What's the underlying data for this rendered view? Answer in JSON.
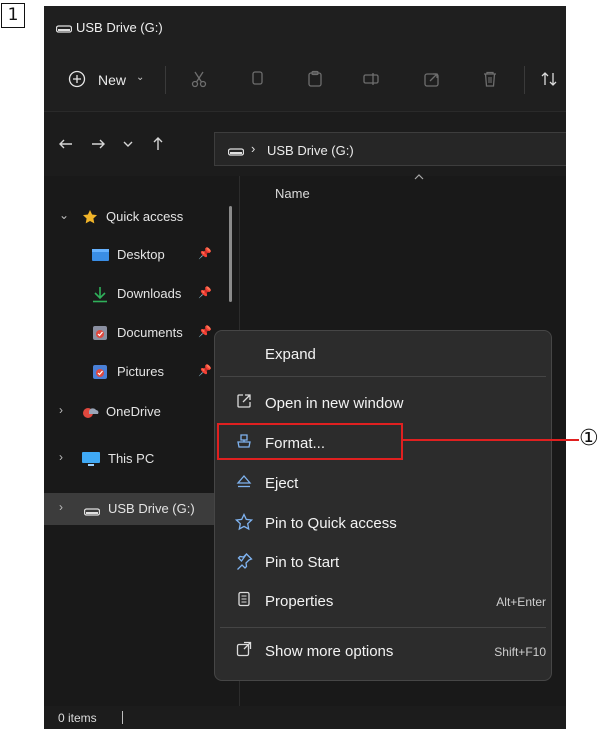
{
  "step_number": "1",
  "callout_number": "①",
  "window": {
    "title": "USB Drive (G:)",
    "drive_icon": "drive-icon"
  },
  "toolbar": {
    "new_label": "New",
    "icons": [
      "cut-icon",
      "copy-icon",
      "paste-icon",
      "rename-icon",
      "share-icon",
      "delete-icon",
      "sort-icon"
    ]
  },
  "navbar": {
    "back_icon": "arrow-left-icon",
    "forward_icon": "arrow-right-icon",
    "recent_icon": "chevron-down-icon",
    "up_icon": "arrow-up-icon",
    "address": "USB Drive (G:)"
  },
  "sidebar": {
    "items": [
      {
        "label": "Quick access",
        "icon": "star-icon",
        "expanded": true,
        "pinned": false
      },
      {
        "label": "Desktop",
        "icon": "desktop-icon",
        "pinned": true
      },
      {
        "label": "Downloads",
        "icon": "download-icon",
        "pinned": true
      },
      {
        "label": "Documents",
        "icon": "documents-icon",
        "pinned": true
      },
      {
        "label": "Pictures",
        "icon": "pictures-icon",
        "pinned": true
      },
      {
        "label": "OneDrive",
        "icon": "onedrive-icon"
      },
      {
        "label": "This PC",
        "icon": "pc-icon"
      },
      {
        "label": "USB Drive (G:)",
        "icon": "drive-icon",
        "selected": true
      }
    ]
  },
  "columns": {
    "name": "Name"
  },
  "context_menu": {
    "items": [
      {
        "label": "Expand",
        "icon": "",
        "shortcut": ""
      },
      {
        "label": "Open in new window",
        "icon": "open-new-window-icon",
        "shortcut": ""
      },
      {
        "label": "Format...",
        "icon": "format-icon",
        "shortcut": ""
      },
      {
        "label": "Eject",
        "icon": "eject-icon",
        "shortcut": ""
      },
      {
        "label": "Pin to Quick access",
        "icon": "star-outline-icon",
        "shortcut": ""
      },
      {
        "label": "Pin to Start",
        "icon": "pin-icon",
        "shortcut": ""
      },
      {
        "label": "Properties",
        "icon": "properties-icon",
        "shortcut": "Alt+Enter"
      },
      {
        "label": "Show more options",
        "icon": "more-options-icon",
        "shortcut": "Shift+F10"
      }
    ]
  },
  "status": {
    "items_count": "0 items"
  },
  "colors": {
    "highlight": "#e02020",
    "accent": "#7fb3f0"
  }
}
